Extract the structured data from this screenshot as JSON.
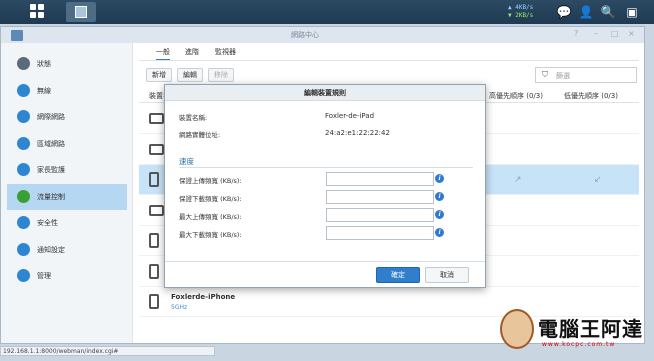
{
  "taskbar": {
    "upload_speed": "▲ 4KB/s",
    "download_speed": "▼ 2KB/s",
    "icons": [
      "grid-menu-icon",
      "network-center-app-icon",
      "chat-icon",
      "user-icon",
      "search-icon",
      "widgets-icon"
    ]
  },
  "window": {
    "title": "網路中心",
    "controls": [
      "?",
      "–",
      "□",
      "×"
    ]
  },
  "sidebar": {
    "items": [
      {
        "label": "狀態",
        "icon": "status-icon",
        "color": "#5b6b7a"
      },
      {
        "label": "無線",
        "icon": "wifi-icon",
        "color": "#2e86d1"
      },
      {
        "label": "網際網路",
        "icon": "globe-icon",
        "color": "#2e86d1"
      },
      {
        "label": "區域網路",
        "icon": "lan-icon",
        "color": "#2e86d1"
      },
      {
        "label": "家長監護",
        "icon": "family-icon",
        "color": "#2e86d1"
      },
      {
        "label": "流量控制",
        "icon": "traffic-icon",
        "color": "#3aa035"
      },
      {
        "label": "安全性",
        "icon": "shield-icon",
        "color": "#2e86d1"
      },
      {
        "label": "通知設定",
        "icon": "notification-icon",
        "color": "#2e86d1"
      },
      {
        "label": "管理",
        "icon": "tools-icon",
        "color": "#2e86d1"
      }
    ],
    "active_index": 5
  },
  "main": {
    "tabs": [
      {
        "label": "一般"
      },
      {
        "label": "進階"
      },
      {
        "label": "監視器"
      }
    ],
    "toolbar": {
      "add": "新增",
      "edit": "編輯",
      "remove": "移除",
      "filter_placeholder": "篩選"
    },
    "columns": {
      "device": "裝置名",
      "upload_priority": "高優先順序 (0/3)",
      "download_priority": "低優先順序 (0/3)"
    },
    "rows": [
      {
        "type": "laptop",
        "name": "",
        "sub": ""
      },
      {
        "type": "laptop",
        "name": "",
        "sub": ""
      },
      {
        "type": "phone",
        "name": "",
        "sub": ""
      },
      {
        "type": "laptop",
        "name": "",
        "sub": ""
      },
      {
        "type": "phone",
        "name": "",
        "sub": ""
      },
      {
        "type": "phone",
        "name": "",
        "sub": ""
      },
      {
        "type": "phone",
        "name": "Foxlerde-iPhone",
        "sub": "5GHz"
      }
    ]
  },
  "modal": {
    "title": "編輯裝置規則",
    "device_name_label": "裝置名稱:",
    "device_name_value": "Foxler-de-iPad",
    "mac_label": "網路實體位址:",
    "mac_value": "24:a2:e1:22:22:42",
    "section": "速度",
    "fields": [
      {
        "label": "保證上傳頻寬 (KB/s):",
        "value": ""
      },
      {
        "label": "保證下載頻寬 (KB/s):",
        "value": ""
      },
      {
        "label": "最大上傳頻寬 (KB/s):",
        "value": ""
      },
      {
        "label": "最大下載頻寬 (KB/s):",
        "value": ""
      }
    ],
    "ok": "確定",
    "cancel": "取消"
  },
  "status_bar": "192.168.1.1:8000/webman/index.cgi#",
  "watermark": {
    "text": "電腦王阿達",
    "url": "www.kocpc.com.tw"
  }
}
